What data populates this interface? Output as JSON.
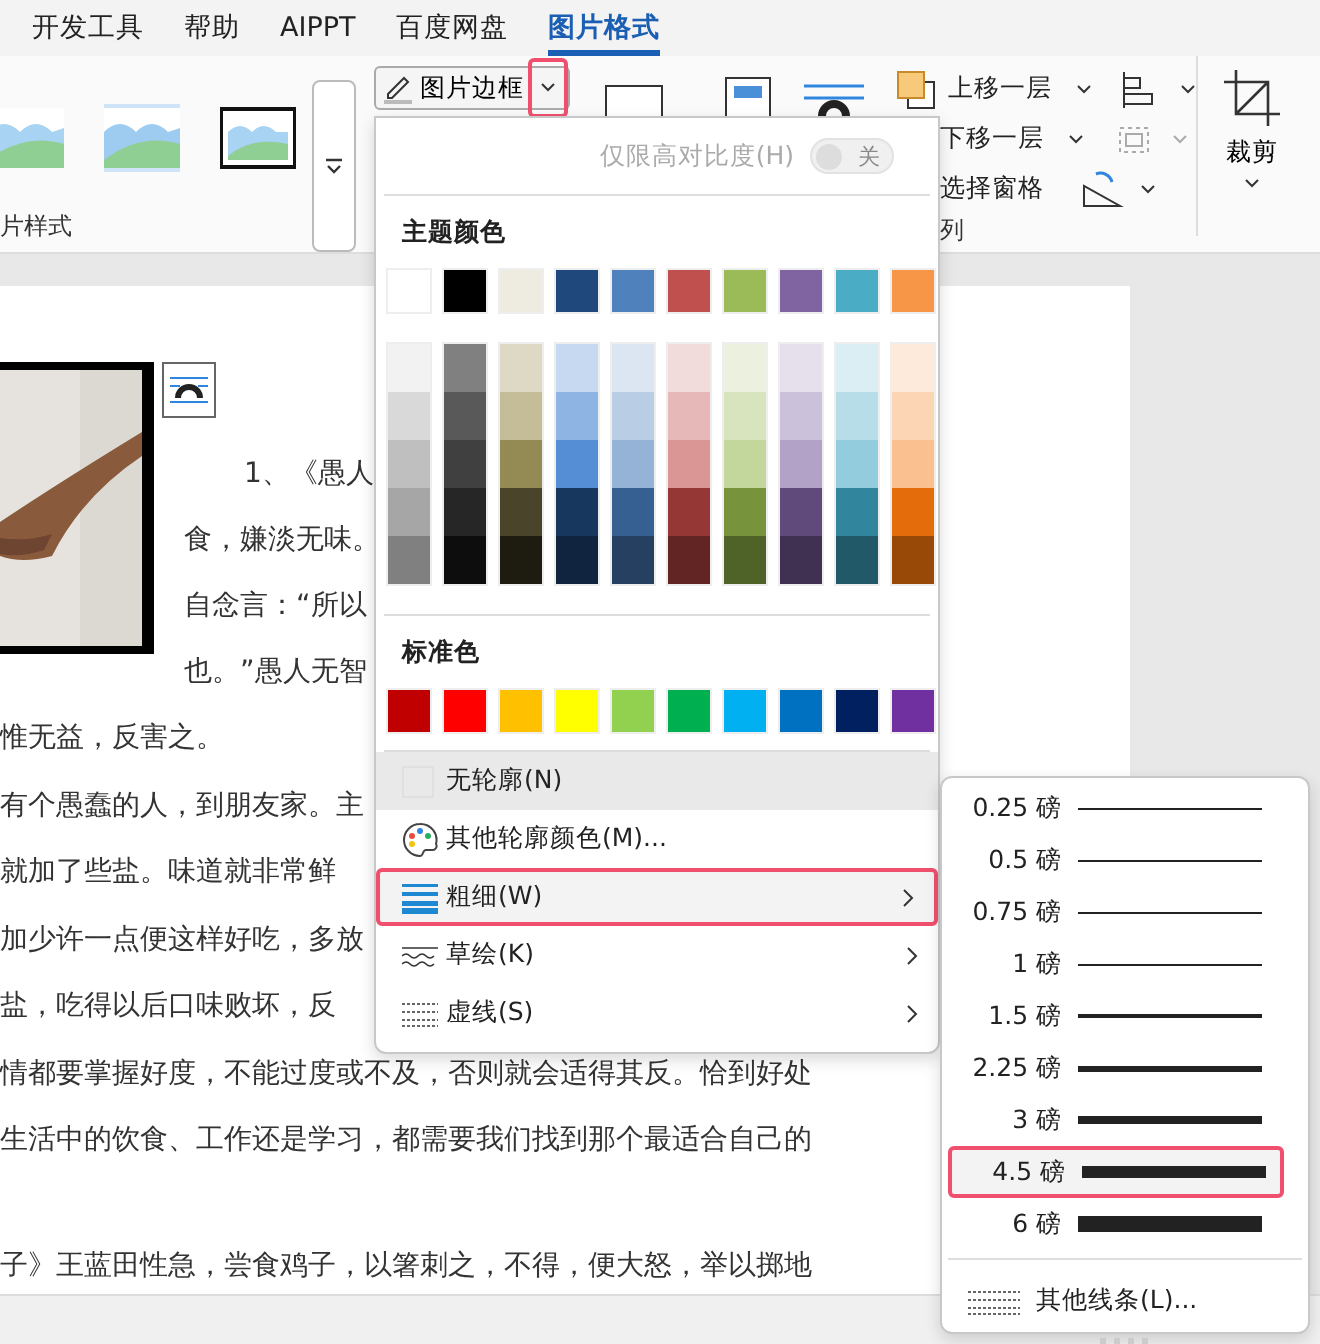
{
  "tabs": [
    {
      "label": "开发工具",
      "selected": false
    },
    {
      "label": "帮助",
      "selected": false
    },
    {
      "label": "AIPPT",
      "selected": false
    },
    {
      "label": "百度网盘",
      "selected": false
    },
    {
      "label": "图片格式",
      "selected": true
    }
  ],
  "ribbon": {
    "styles_group_label": "片样式",
    "border_button": "图片边框",
    "bring_forward": "上移一层",
    "send_backward": "下移一层",
    "selection_pane": "选择窗格",
    "arrange_group_label": "列",
    "crop": "裁剪"
  },
  "document": {
    "lines": [
      {
        "text": "1、《愚人",
        "kind": "indent"
      },
      {
        "text": "食，嫌淡无味。",
        "kind": "beside"
      },
      {
        "text": "自念言：“所以",
        "kind": "beside"
      },
      {
        "text": "也。”愚人无智",
        "kind": "beside"
      },
      {
        "text": "惟无益，反害之。",
        "kind": "full"
      },
      {
        "text": "有个愚蠢的人，到朋友家。主",
        "kind": "full"
      },
      {
        "text": "就加了些盐。味道就非常鲜",
        "kind": "full"
      },
      {
        "text": "加少许一点便这样好吃，多放",
        "kind": "full"
      },
      {
        "text": "盐，吃得以后口味败坏，反",
        "kind": "full"
      },
      {
        "text": "情都要掌握好度，不能过度或不及，否则就会适得其反。恰到好处",
        "kind": "full"
      },
      {
        "text": "生活中的饮食、工作还是学习，都需要我们找到那个最适合自己的",
        "kind": "full"
      },
      {
        "text": "子》王蓝田性急，尝食鸡子，以箸刺之，不得，便大怒，举以掷地",
        "kind": "gap"
      }
    ]
  },
  "border_menu": {
    "high_contrast": {
      "label": "仅限高对比度(H)",
      "on": false,
      "state_text": "关"
    },
    "theme_heading": "主题颜色",
    "theme_colors": [
      {
        "color": "#ffffff",
        "shades": [
          {
            "color": "#f2f2f2"
          },
          {
            "color": "#d9d9d9"
          },
          {
            "color": "#bfbfbf"
          },
          {
            "color": "#a6a6a6"
          },
          {
            "color": "#808080"
          }
        ]
      },
      {
        "color": "#000000",
        "shades": [
          {
            "color": "#808080"
          },
          {
            "color": "#595959"
          },
          {
            "color": "#404040"
          },
          {
            "color": "#262626"
          },
          {
            "color": "#0d0d0d"
          }
        ]
      },
      {
        "color": "#eeece1",
        "shades": [
          {
            "color": "#ddd9c4"
          },
          {
            "color": "#c4bd97"
          },
          {
            "color": "#948a54"
          },
          {
            "color": "#4a452a"
          },
          {
            "color": "#1e1c11"
          }
        ]
      },
      {
        "color": "#1f497d",
        "shades": [
          {
            "color": "#c6d9f1"
          },
          {
            "color": "#8eb4e3"
          },
          {
            "color": "#558ed5"
          },
          {
            "color": "#17375e"
          },
          {
            "color": "#10243f"
          }
        ]
      },
      {
        "color": "#4f81bd",
        "shades": [
          {
            "color": "#dce6f2"
          },
          {
            "color": "#b9cde5"
          },
          {
            "color": "#95b3d7"
          },
          {
            "color": "#376092"
          },
          {
            "color": "#254061"
          }
        ]
      },
      {
        "color": "#c0504d",
        "shades": [
          {
            "color": "#f2dcdb"
          },
          {
            "color": "#e6b9b8"
          },
          {
            "color": "#d99694"
          },
          {
            "color": "#953735"
          },
          {
            "color": "#632523"
          }
        ]
      },
      {
        "color": "#9bbb59",
        "shades": [
          {
            "color": "#ebf1de"
          },
          {
            "color": "#d7e4bd"
          },
          {
            "color": "#c3d69b"
          },
          {
            "color": "#77933c"
          },
          {
            "color": "#4f6228"
          }
        ]
      },
      {
        "color": "#8064a2",
        "shades": [
          {
            "color": "#e6e0ec"
          },
          {
            "color": "#ccc1da"
          },
          {
            "color": "#b3a2c7"
          },
          {
            "color": "#604a7b"
          },
          {
            "color": "#403152"
          }
        ]
      },
      {
        "color": "#4bacc6",
        "shades": [
          {
            "color": "#dbeef4"
          },
          {
            "color": "#b7dee8"
          },
          {
            "color": "#93cddd"
          },
          {
            "color": "#31859c"
          },
          {
            "color": "#215968"
          }
        ]
      },
      {
        "color": "#f79646",
        "shades": [
          {
            "color": "#fdeada"
          },
          {
            "color": "#fcd5b5"
          },
          {
            "color": "#fac090"
          },
          {
            "color": "#e46c0a"
          },
          {
            "color": "#984807"
          }
        ]
      }
    ],
    "standard_heading": "标准色",
    "standard_colors": [
      {
        "color": "#c00000"
      },
      {
        "color": "#ff0000"
      },
      {
        "color": "#ffc000"
      },
      {
        "color": "#ffff00"
      },
      {
        "color": "#92d050"
      },
      {
        "color": "#00b050"
      },
      {
        "color": "#00b0f0"
      },
      {
        "color": "#0070c0"
      },
      {
        "color": "#002060"
      },
      {
        "color": "#7030a0"
      }
    ],
    "items": [
      {
        "label": "无轮廓(N)",
        "kind": "none",
        "selected": false,
        "hovered": true,
        "submenu": false
      },
      {
        "label": "其他轮廓颜色(M)...",
        "kind": "palette",
        "selected": false,
        "hovered": false,
        "submenu": false
      },
      {
        "label": "粗细(W)",
        "kind": "weight",
        "selected": true,
        "hovered": false,
        "submenu": true
      },
      {
        "label": "草绘(K)",
        "kind": "sketch",
        "selected": false,
        "hovered": false,
        "submenu": true
      },
      {
        "label": "虚线(S)",
        "kind": "dash",
        "selected": false,
        "hovered": false,
        "submenu": true
      }
    ]
  },
  "weight_menu": {
    "items": [
      {
        "label": "0.25 磅",
        "selected": false
      },
      {
        "label": "0.5 磅",
        "selected": false
      },
      {
        "label": "0.75 磅",
        "selected": false
      },
      {
        "label": "1 磅",
        "selected": false
      },
      {
        "label": "1.5 磅",
        "selected": false
      },
      {
        "label": "2.25 磅",
        "selected": false
      },
      {
        "label": "3 磅",
        "selected": false
      },
      {
        "label": "4.5 磅",
        "selected": true
      },
      {
        "label": "6 磅",
        "selected": false
      }
    ],
    "more": "其他线条(L)..."
  }
}
